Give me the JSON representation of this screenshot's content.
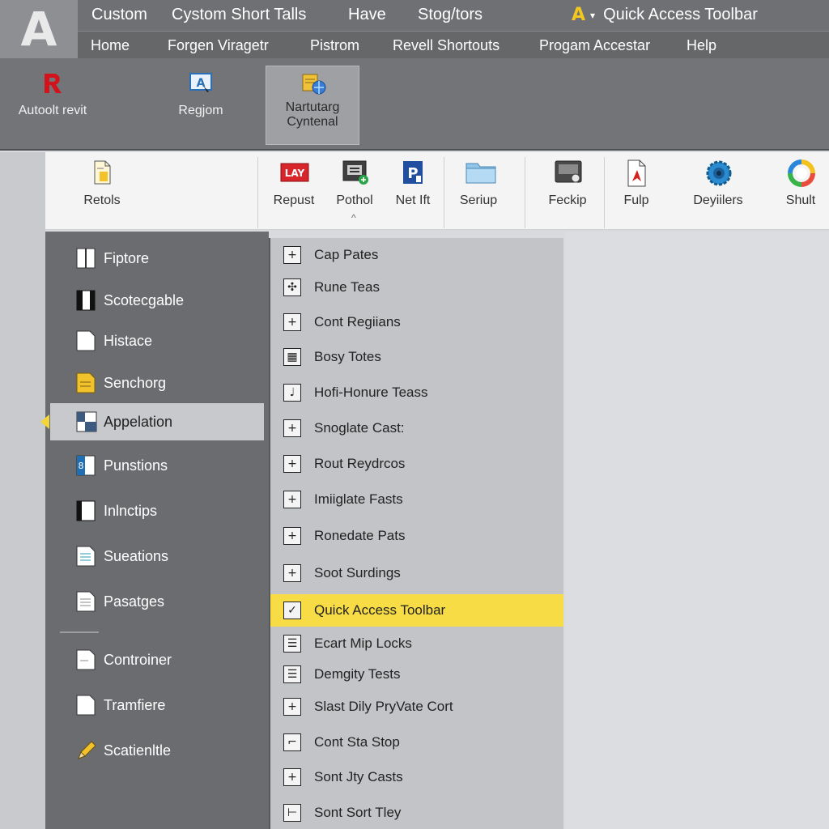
{
  "titlebar": {
    "logo": "A",
    "items": [
      "Custom",
      "Cystom Short Talls",
      "Have",
      "Stog/tors"
    ],
    "qat_logo": "A",
    "qat_caret": "▾",
    "qat_label": "Quick Access Toolbar"
  },
  "menubar": {
    "items": [
      "Home",
      "Forgen Viragetr",
      "Pistrom",
      "Revell Shortouts",
      "Progam Accestar",
      "Help"
    ]
  },
  "ribbon_top": {
    "buttons": [
      {
        "label": "Autoolt revit",
        "icon": "revit-logo-icon"
      },
      {
        "label": "Regjom",
        "icon": "screen-a-icon"
      },
      {
        "label_line1": "Nartutarg",
        "label_line2": "Cyntenal",
        "icon": "folder-globe-icon"
      }
    ]
  },
  "ribbon_2": {
    "buttons": [
      {
        "label": "Retols",
        "icon": "document-icon"
      },
      {
        "label": "Repust",
        "icon_text": "LAY",
        "icon": "lay-icon"
      },
      {
        "label": "Pothol",
        "icon": "monitor-icon"
      },
      {
        "label": "Net Ift",
        "icon_text": "P",
        "icon": "p-tile-icon"
      },
      {
        "label": "Seriup",
        "icon": "folder-icon"
      },
      {
        "label": "Feckip",
        "icon": "display-icon"
      },
      {
        "label": "Fulp",
        "icon": "pdf-icon"
      },
      {
        "label": "Deyiilers",
        "icon": "gear-icon"
      },
      {
        "label": "Shult",
        "icon": "color-wheel-icon"
      }
    ],
    "caret": "^"
  },
  "categories": {
    "items": [
      "Fiptore",
      "Scotecgable",
      "Histace",
      "Senchorg",
      "Appelation",
      "Punstions",
      "Inlnctips",
      "Sueations",
      "Pasatges",
      "Controiner",
      "Tramfiere",
      "Scatienltle"
    ],
    "active_index": 4
  },
  "commands": {
    "items": [
      {
        "label": "Cap Pates",
        "glyph": "+"
      },
      {
        "label": "Rune Teas",
        "glyph": "✣"
      },
      {
        "label": "Cont Regiians",
        "glyph": "+"
      },
      {
        "label": "Bosy Totes",
        "glyph": "▦"
      },
      {
        "label": "Hofi-Honure Teass",
        "glyph": "♩"
      },
      {
        "label": "Snoglate Cast:",
        "glyph": "+"
      },
      {
        "label": "Rout Reydrcos",
        "glyph": "+"
      },
      {
        "label": "Imiiglate Fasts",
        "glyph": "+"
      },
      {
        "label": "Ronedate Pats",
        "glyph": "+"
      },
      {
        "label": "Soot Surdings",
        "glyph": "+"
      },
      {
        "label": "Quick Access Toolbar",
        "glyph": "✓"
      },
      {
        "label": "Ecart Mip Locks",
        "glyph": "☰"
      },
      {
        "label": "Demgity Tests",
        "glyph": "☰"
      },
      {
        "label": "Slast Dily PryVate Cort",
        "glyph": "+"
      },
      {
        "label": "Cont Sta Stop",
        "glyph": "⌐"
      },
      {
        "label": "Sont Jty Casts",
        "glyph": "+"
      },
      {
        "label": "Sont Sort Tley",
        "glyph": "⊢"
      }
    ],
    "active_index": 10
  },
  "colors": {
    "accent": "#f7dc45",
    "titlebar": "#6f7073",
    "panel": "#6b6c6f"
  }
}
